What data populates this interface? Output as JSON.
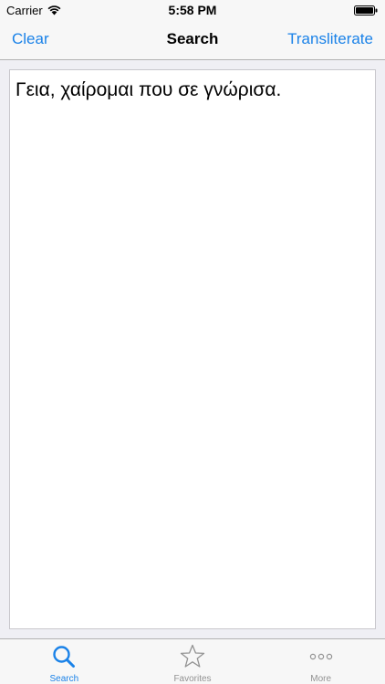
{
  "status_bar": {
    "carrier": "Carrier",
    "time": "5:58 PM"
  },
  "nav_bar": {
    "left_button": "Clear",
    "title": "Search",
    "right_button": "Transliterate"
  },
  "text_area": {
    "value": "Γεια, χαίρομαι που σε γνώρισα."
  },
  "tab_bar": {
    "tabs": [
      {
        "label": "Search",
        "icon": "search-icon",
        "selected": true
      },
      {
        "label": "Favorites",
        "icon": "star-icon",
        "selected": false
      },
      {
        "label": "More",
        "icon": "more-icon",
        "selected": false
      }
    ]
  },
  "colors": {
    "accent": "#1a82e8",
    "inactive": "#929292",
    "bar_background": "#f7f7f7",
    "page_background": "#efeff4"
  }
}
